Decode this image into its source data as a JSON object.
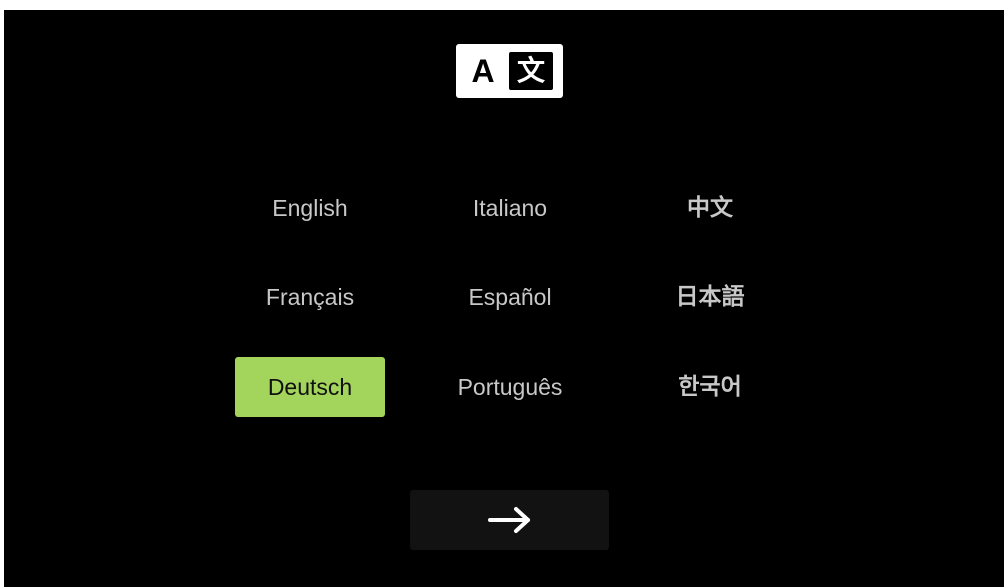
{
  "logo": {
    "letter": "A",
    "glyph": "文",
    "icon": "translate-icon"
  },
  "languages": [
    {
      "label": "English"
    },
    {
      "label": "Italiano"
    },
    {
      "label": "中文"
    },
    {
      "label": "Français"
    },
    {
      "label": "Español"
    },
    {
      "label": "日本語"
    },
    {
      "label": "Deutsch",
      "selected": true
    },
    {
      "label": "Português"
    },
    {
      "label": "한국어"
    }
  ],
  "next_button": {
    "icon": "arrow-right-icon"
  },
  "colors": {
    "background": "#000000",
    "selected": "#a3d45c",
    "text": "#c8c8c8",
    "button": "#121212"
  }
}
